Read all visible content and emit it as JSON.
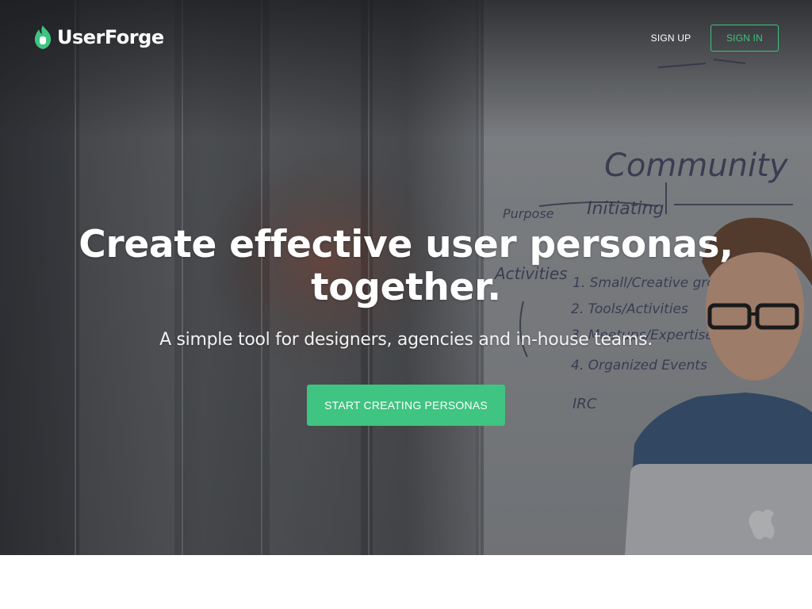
{
  "brand": {
    "name": "UserForge",
    "logo_icon": "flame-icon",
    "accent_color": "#3fc481"
  },
  "nav": {
    "signup_label": "SIGN UP",
    "signin_label": "SIGN IN"
  },
  "hero": {
    "headline_line1": "Create effective user personas,",
    "headline_line2": "together.",
    "subheadline": "A simple tool for designers, agencies and in-house teams.",
    "cta_label": "START CREATING PERSONAS",
    "whiteboard_text": [
      "Community",
      "Initiating",
      "Purpose",
      "Activities",
      "1. Small/Creative groups",
      "2. Tools/Activities",
      "3. Meetups/Expertise",
      "4. Organized Events",
      "IRC"
    ]
  }
}
